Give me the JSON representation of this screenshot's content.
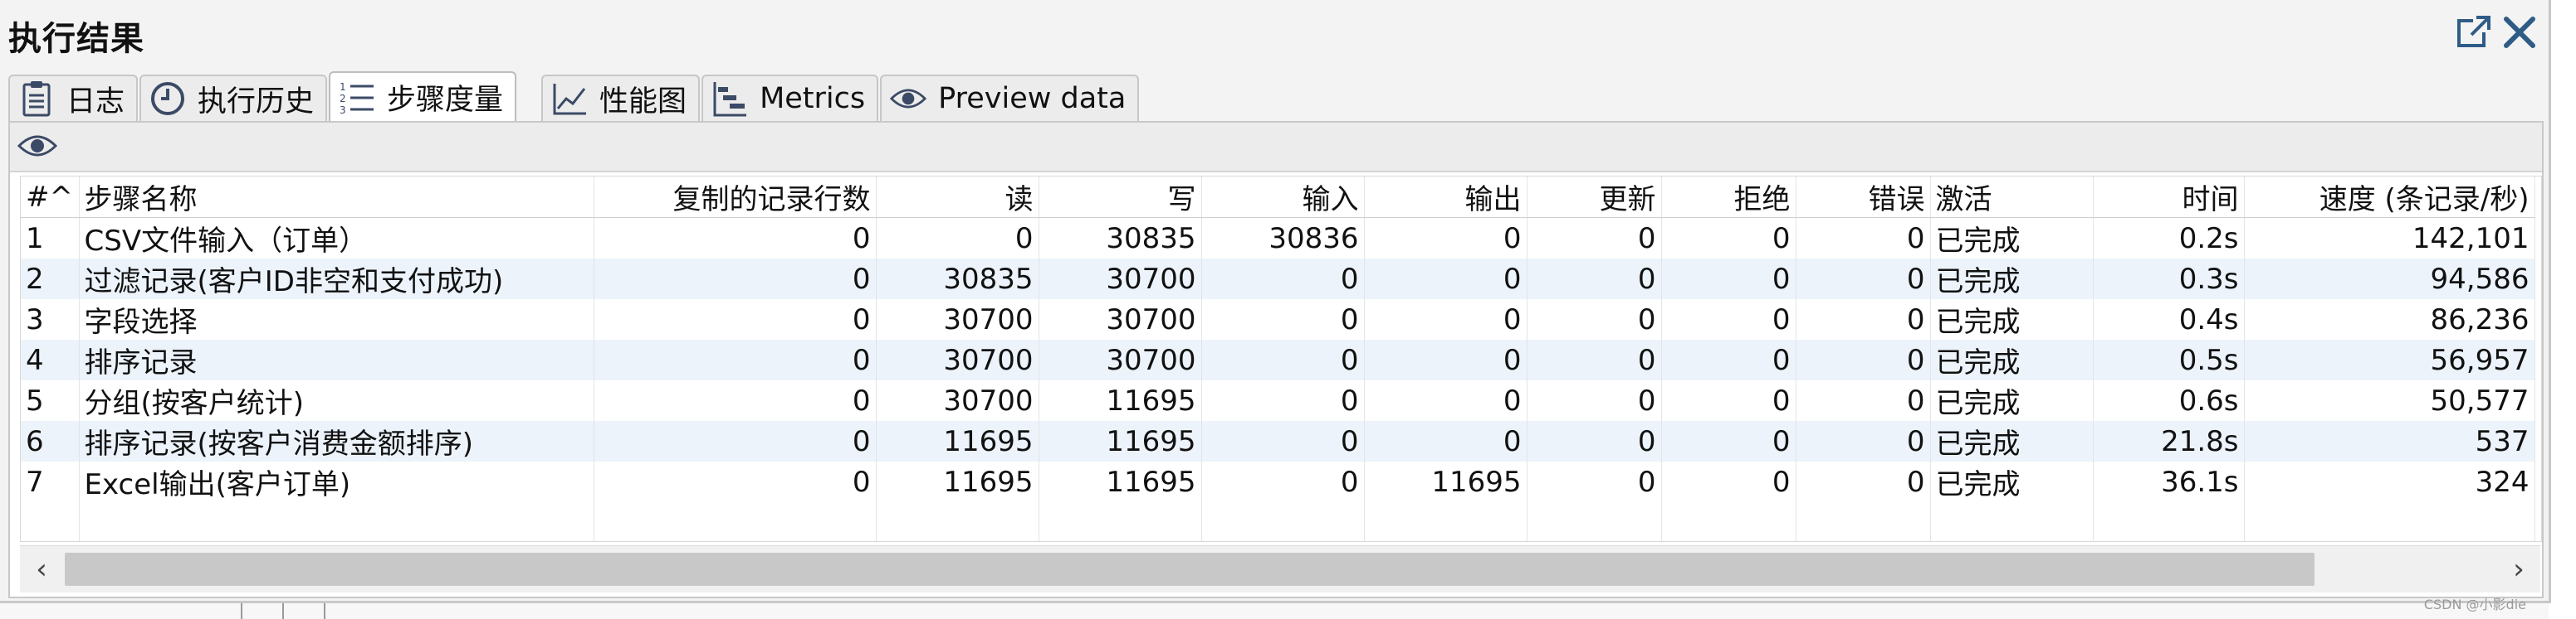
{
  "window": {
    "title": "执行结果",
    "popout_icon": "external-open-icon",
    "close_icon": "close-icon"
  },
  "tabs": [
    {
      "label": "日志",
      "icon": "log-clipboard-icon",
      "active": false
    },
    {
      "label": "执行历史",
      "icon": "history-clock-icon",
      "active": false
    },
    {
      "label": "步骤度量",
      "icon": "numbered-list-icon",
      "active": true
    },
    {
      "label": "性能图",
      "icon": "line-chart-icon",
      "active": false
    },
    {
      "label": "Metrics",
      "icon": "gantt-metrics-icon",
      "active": false
    },
    {
      "label": "Preview data",
      "icon": "eye-icon",
      "active": false
    }
  ],
  "toolbar": {
    "icon": "eye-icon"
  },
  "table": {
    "columns": [
      "#^",
      "步骤名称",
      "复制的记录行数",
      "读",
      "写",
      "输入",
      "输出",
      "更新",
      "拒绝",
      "错误",
      "激活",
      "时间",
      "速度 (条记录/秒)"
    ],
    "rows": [
      [
        "1",
        "CSV文件输入（订单）",
        "0",
        "0",
        "30835",
        "30836",
        "0",
        "0",
        "0",
        "0",
        "已完成",
        "0.2s",
        "142,101"
      ],
      [
        "2",
        "过滤记录(客户ID非空和支付成功)",
        "0",
        "30835",
        "30700",
        "0",
        "0",
        "0",
        "0",
        "0",
        "已完成",
        "0.3s",
        "94,586"
      ],
      [
        "3",
        "字段选择",
        "0",
        "30700",
        "30700",
        "0",
        "0",
        "0",
        "0",
        "0",
        "已完成",
        "0.4s",
        "86,236"
      ],
      [
        "4",
        "排序记录",
        "0",
        "30700",
        "30700",
        "0",
        "0",
        "0",
        "0",
        "0",
        "已完成",
        "0.5s",
        "56,957"
      ],
      [
        "5",
        "分组(按客户统计)",
        "0",
        "30700",
        "11695",
        "0",
        "0",
        "0",
        "0",
        "0",
        "已完成",
        "0.6s",
        "50,577"
      ],
      [
        "6",
        "排序记录(按客户消费金额排序)",
        "0",
        "11695",
        "11695",
        "0",
        "0",
        "0",
        "0",
        "0",
        "已完成",
        "21.8s",
        "537"
      ],
      [
        "7",
        "Excel输出(客户订单)",
        "0",
        "11695",
        "11695",
        "0",
        "11695",
        "0",
        "0",
        "0",
        "已完成",
        "36.1s",
        "324"
      ]
    ]
  },
  "scrollbar": {
    "left_arrow": "‹",
    "right_arrow": "›"
  },
  "watermark": "CSDN @小影die"
}
